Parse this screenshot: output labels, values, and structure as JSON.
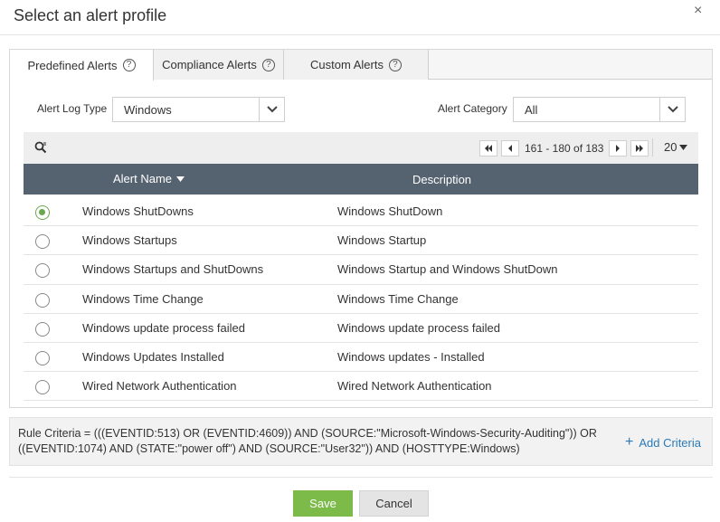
{
  "dialog": {
    "title": "Select an alert profile",
    "close_glyph": "×"
  },
  "tabs": [
    {
      "label": "Predefined Alerts",
      "help": "?",
      "active": true
    },
    {
      "label": "Compliance Alerts",
      "help": "?",
      "active": false
    },
    {
      "label": "Custom Alerts",
      "help": "?",
      "active": false
    }
  ],
  "filters": {
    "log_type_label": "Alert Log Type",
    "log_type_value": "Windows",
    "category_label": "Alert Category",
    "category_value": "All"
  },
  "pager": {
    "range_text": "161 - 180 of 183",
    "page_size": "20"
  },
  "grid": {
    "col_name": "Alert Name",
    "col_desc": "Description",
    "rows": [
      {
        "name": "Windows ShutDowns",
        "desc": "Windows ShutDown",
        "selected": true
      },
      {
        "name": "Windows Startups",
        "desc": "Windows Startup",
        "selected": false
      },
      {
        "name": "Windows Startups and ShutDowns",
        "desc": "Windows Startup and Windows ShutDown",
        "selected": false
      },
      {
        "name": "Windows Time Change",
        "desc": "Windows Time Change",
        "selected": false
      },
      {
        "name": "Windows update process failed",
        "desc": "Windows update process failed",
        "selected": false
      },
      {
        "name": "Windows Updates Installed",
        "desc": "Windows updates - Installed",
        "selected": false
      },
      {
        "name": "Wired Network Authentication",
        "desc": "Wired Network Authentication",
        "selected": false
      }
    ]
  },
  "criteria": {
    "text": "Rule Criteria = (((EVENTID:513) OR (EVENTID:4609)) AND (SOURCE:\"Microsoft-Windows-Security-Auditing\")) OR ((EVENTID:1074) AND (STATE:\"power off\") AND (SOURCE:\"User32\")) AND (HOSTTYPE:Windows)",
    "add_label": "Add Criteria",
    "add_glyph": "+"
  },
  "footer": {
    "save_label": "Save",
    "cancel_label": "Cancel"
  },
  "colors": {
    "accent": "#7cba4a",
    "header": "#556270",
    "link": "#2a7ab8",
    "radio_checked": "#6aa84f"
  }
}
